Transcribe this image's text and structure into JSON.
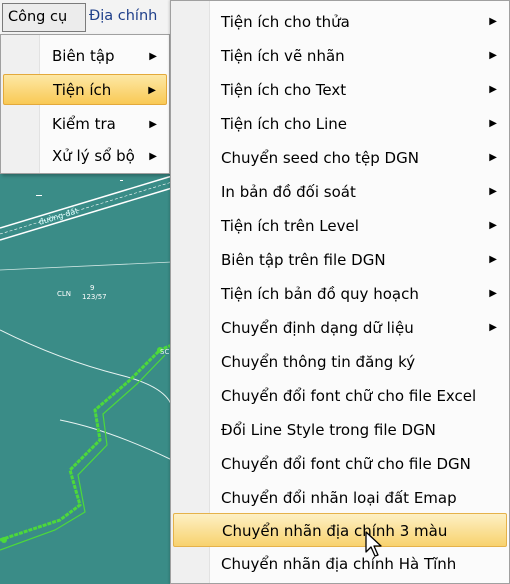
{
  "menubar": {
    "items": [
      {
        "label": "Công cụ"
      },
      {
        "label": "Địa chính"
      }
    ]
  },
  "submenu1": {
    "items": [
      {
        "label": "Biên tập",
        "arrow": "▶"
      },
      {
        "label": "Tiện ích",
        "arrow": "▶"
      },
      {
        "label": "Kiểm tra",
        "arrow": "▶"
      },
      {
        "label": "Xử lý sổ bộ",
        "arrow": "▶"
      }
    ],
    "highlighted_index": 1
  },
  "submenu2": {
    "items": [
      {
        "label": "Tiện ích cho thửa",
        "arrow": "▶"
      },
      {
        "label": "Tiện ích vẽ nhãn",
        "arrow": "▶"
      },
      {
        "label": "Tiện ích cho Text",
        "arrow": "▶"
      },
      {
        "label": "Tiện ích cho Line",
        "arrow": "▶"
      },
      {
        "label": "Chuyển seed cho tệp DGN",
        "arrow": "▶"
      },
      {
        "label": "In bản đồ đối soát",
        "arrow": "▶"
      },
      {
        "label": "Tiện ích trên Level",
        "arrow": "▶"
      },
      {
        "label": "Biên tập trên file DGN",
        "arrow": "▶"
      },
      {
        "label": "Tiện ích bản đồ quy hoạch",
        "arrow": "▶"
      },
      {
        "label": "Chuyển định dạng dữ liệu",
        "arrow": "▶"
      },
      {
        "label": "Chuyển thông tin đăng ký"
      },
      {
        "label": "Chuyển đổi font chữ cho file Excel"
      },
      {
        "label": "Đổi Line Style trong file DGN"
      },
      {
        "label": "Chuyển đổi font chữ cho file DGN"
      },
      {
        "label": "Chuyển đổi nhãn loại đất Emap"
      },
      {
        "label": "Chuyển nhãn địa chính 3 màu"
      },
      {
        "label": "Chuyển nhãn địa chính Hà Tĩnh"
      }
    ],
    "highlighted_index": 15
  },
  "map": {
    "road_label": "đường đất",
    "parcel_label": "CLN",
    "parcel_number": "9",
    "parcel_area": "123/57",
    "edge_label": "SC",
    "colors": {
      "background": "#3a8c87",
      "boundary": "#4cd93a"
    }
  }
}
